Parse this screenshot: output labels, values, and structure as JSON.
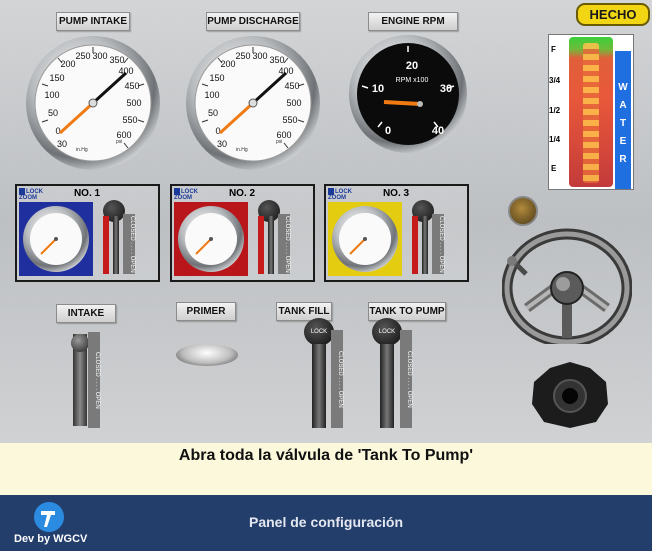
{
  "done_button": "HECHO",
  "gauges": {
    "intake": {
      "title": "PUMP INTAKE",
      "labels": [
        "30",
        "0",
        "50",
        "100",
        "150",
        "200",
        "250",
        "300",
        "350",
        "400",
        "450",
        "500",
        "550",
        "600"
      ],
      "unit_left": "in.Hg",
      "unit_right": "psi",
      "needle_value_psi": 0
    },
    "discharge": {
      "title": "PUMP DISCHARGE",
      "labels": [
        "30",
        "0",
        "50",
        "100",
        "150",
        "200",
        "250",
        "300",
        "350",
        "400",
        "450",
        "500",
        "550",
        "600"
      ],
      "unit_left": "in.Hg",
      "unit_right": "psi",
      "needle_value_psi": 0
    },
    "rpm": {
      "title": "ENGINE RPM",
      "labels": [
        "0",
        "10",
        "20",
        "30",
        "40"
      ],
      "unit": "RPM x100",
      "needle_value": 10
    }
  },
  "tank": {
    "levels": [
      "F",
      "3/4",
      "1/2",
      "1/4",
      "E"
    ],
    "side_label": [
      "W",
      "A",
      "T",
      "E",
      "R"
    ],
    "fill_fraction": 1.0
  },
  "discharges": [
    {
      "title": "NO. 1",
      "lock_label": "LOCK ZOOM",
      "gauge_color": "#1f2f9e",
      "valve_labels": {
        "closed": "CLOSED",
        "open": "OPEN"
      }
    },
    {
      "title": "NO. 2",
      "lock_label": "LOCK ZOOM",
      "gauge_color": "#b8161b",
      "valve_labels": {
        "closed": "CLOSED",
        "open": "OPEN"
      }
    },
    {
      "title": "NO. 3",
      "lock_label": "LOCK ZOOM",
      "gauge_color": "#e4cc10",
      "valve_labels": {
        "closed": "CLOSED",
        "open": "OPEN"
      }
    }
  ],
  "controls": {
    "intake": {
      "label": "INTAKE",
      "closed": "CLOSED",
      "open": "OPEN"
    },
    "primer": {
      "label": "PRIMER"
    },
    "tank_fill": {
      "label": "TANK FILL",
      "closed": "CLOSED",
      "open": "OPEN",
      "lock": "LOCK"
    },
    "tank_to_pump": {
      "label": "TANK TO PUMP",
      "closed": "CLOSED",
      "open": "OPEN",
      "lock": "LOCK"
    }
  },
  "message": "Abra toda la válvula de 'Tank To Pump'",
  "footer": {
    "config": "Panel de configuración",
    "dev": "Dev by WGCV"
  }
}
